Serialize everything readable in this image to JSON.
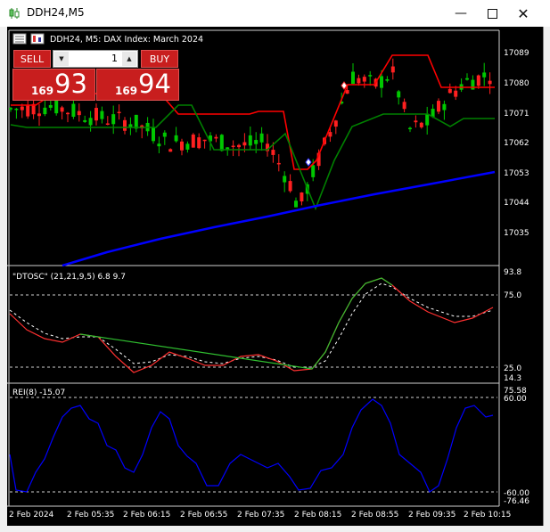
{
  "window": {
    "title": "DDH24,M5",
    "minimize_icon": "minimize-icon",
    "maximize_icon": "maximize-icon",
    "close_icon": "close-icon"
  },
  "chart": {
    "header": "DDH24, M5:  DAX Index: March 2024",
    "price_axis": [
      "17089",
      "17080",
      "17071",
      "17062",
      "17053",
      "17044",
      "17035"
    ],
    "time_axis": [
      "2 Feb 2024",
      "2 Feb 05:35",
      "2 Feb 06:15",
      "2 Feb 06:55",
      "2 Feb 07:35",
      "2 Feb 08:15",
      "2 Feb 08:55",
      "2 Feb 09:35",
      "2 Feb 10:15"
    ],
    "colors": {
      "background": "#000000",
      "bull_candle": "#00c800",
      "bear_candle": "#ff2020",
      "stop_line_red": "#ff0000",
      "stop_line_green": "#008000",
      "moving_average": "#0000ff",
      "rei_line": "#0000ff"
    }
  },
  "trade": {
    "sell_label": "SELL",
    "buy_label": "BUY",
    "quantity": "1",
    "sell_price_small": "169",
    "sell_price_big": "93",
    "buy_price_small": "169",
    "buy_price_big": "94"
  },
  "dtosc": {
    "label": "\"DTOSC\" (21,21,9,5) 6.8 9.7",
    "axis": [
      "93.8",
      "75.0",
      "25.0",
      "14.3"
    ]
  },
  "rei": {
    "label": "REI(8) -15.07",
    "axis": [
      "75.58",
      "60.00",
      "-60.00",
      "-76.46"
    ]
  }
}
